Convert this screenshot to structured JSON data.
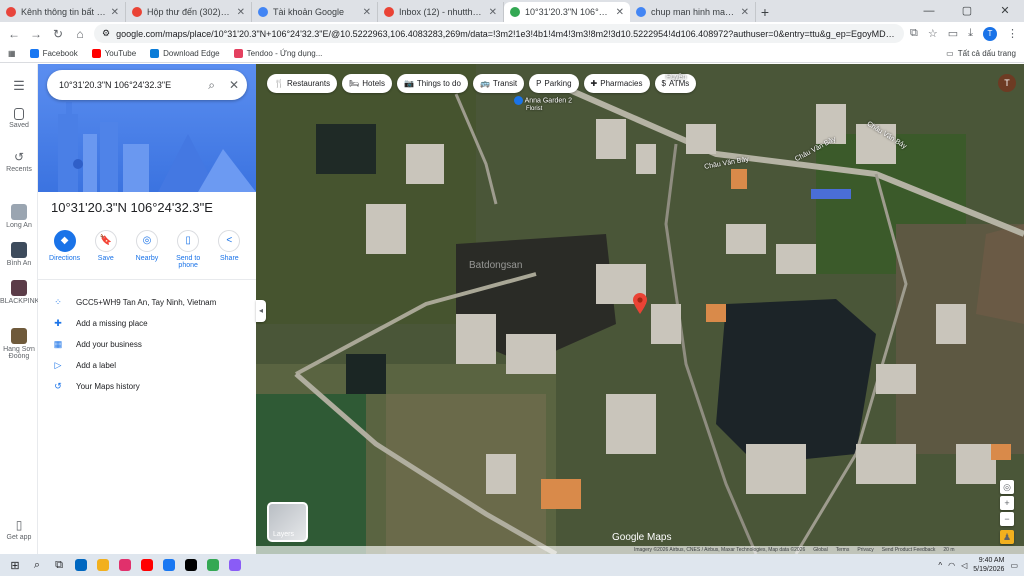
{
  "browser": {
    "tabs": [
      {
        "title": "Kênh thông tin bất động sản",
        "color": "#e8453c",
        "active": false
      },
      {
        "title": "Hộp thư đến (302) - tranhutr",
        "color": "#ea4335",
        "active": false
      },
      {
        "title": "Tài khoản Google",
        "color": "#4285f4",
        "active": false
      },
      {
        "title": "Inbox (12) - nhutthanhnt496@",
        "color": "#ea4335",
        "active": false
      },
      {
        "title": "10°31'20.3\"N 106°24'32.3\"E - G",
        "color": "#34a853",
        "active": true
      },
      {
        "title": "chup man hinh may tinh - Goo",
        "color": "#4285f4",
        "active": false
      }
    ],
    "url": "google.com/maps/place/10°31'20.3\"N+106°24'32.3\"E/@10.5222963,106.4083283,269m/data=!3m2!1e3!4b1!4m4!3m3!8m2!3d10.5222954!4d106.408972?authuser=0&entry=ttu&g_ep=EgoyMDI2MDUxMy4wIKXMDSoASAFQAw%3D%3D",
    "bookmarks": [
      {
        "label": "Facebook",
        "color": "#1877f2"
      },
      {
        "label": "YouTube",
        "color": "#ff0000"
      },
      {
        "label": "Download Edge",
        "color": "#0a7cd8"
      },
      {
        "label": "Tendoo - Ứng dụng...",
        "color": "#e4405f"
      }
    ],
    "bookmarks_right": "Tất cả dấu trang",
    "profile_initial": "T"
  },
  "rail": [
    {
      "label": "Saved"
    },
    {
      "label": "Recents"
    },
    {
      "label": "Long An"
    },
    {
      "label": "Bình An"
    },
    {
      "label": "BLACKPINK..."
    },
    {
      "label": "Hang Sơn Đoòng"
    },
    {
      "label": "Get app"
    }
  ],
  "panel": {
    "search_value": "10°31'20.3\"N 106°24'32.3\"E",
    "title": "10°31'20.3\"N 106°24'32.3\"E",
    "actions": [
      {
        "label": "Directions",
        "icon": "◆"
      },
      {
        "label": "Save",
        "icon": "🔖"
      },
      {
        "label": "Nearby",
        "icon": "◎"
      },
      {
        "label": "Send to phone",
        "icon": "▯"
      },
      {
        "label": "Share",
        "icon": "<"
      }
    ],
    "info": [
      {
        "text": "GCC5+WH9 Tan An, Tay Ninh, Vietnam",
        "icon": "⁘"
      },
      {
        "text": "Add a missing place",
        "icon": "✚"
      },
      {
        "text": "Add your business",
        "icon": "▦"
      },
      {
        "text": "Add a label",
        "icon": "▷"
      },
      {
        "text": "Your Maps history",
        "icon": "↺"
      }
    ]
  },
  "map": {
    "chips": [
      {
        "label": "Restaurants",
        "icon": "🍴"
      },
      {
        "label": "Hotels",
        "icon": "🛏"
      },
      {
        "label": "Things to do",
        "icon": "📷"
      },
      {
        "label": "Transit",
        "icon": "🚌"
      },
      {
        "label": "Parking",
        "icon": "P"
      },
      {
        "label": "Pharmacies",
        "icon": "✚"
      },
      {
        "label": "ATMs",
        "icon": "$"
      }
    ],
    "labels": {
      "road1": "Châu Văn Bảy",
      "road2": "Châu Văn Bảy",
      "road3": "Châu Văn Bảy",
      "place": "Anna Garden 2",
      "place_sub": "Florist",
      "top": "Huyền"
    },
    "watermark": "Batdongsan",
    "layers_label": "Layers",
    "logo": "Google Maps",
    "attribution": [
      "Imagery ©2026 Airbus, CNES / Airbus, Maxar Technologies, Map data ©2026",
      "Global",
      "Terms",
      "Privacy",
      "Send Product Feedback",
      "20 m"
    ]
  },
  "taskbar": {
    "apps": [
      "#0067c0",
      "#f2b01e",
      "#e1306c",
      "#ff0000",
      "#1877f2",
      "#000000",
      "#34a853",
      "#8a5cf6"
    ],
    "time": "9:40 AM",
    "date": "5/19/2026"
  }
}
